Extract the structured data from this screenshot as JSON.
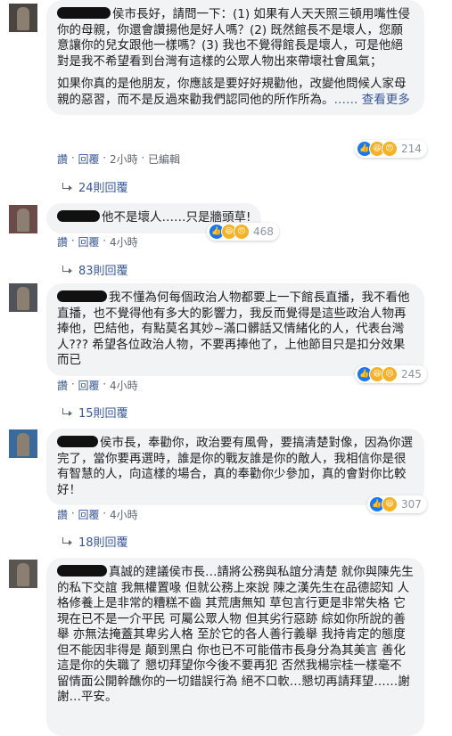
{
  "comments": [
    {
      "text_paragraphs": [
        "侯市長好，請問一下：(1) 如果有人天天照三頓用嘴性侵你的母親，你還會讚揚他是好人嗎？(2) 既然館長不是壞人，您願意讓你的兒女跟他一樣嗎？(3) 我也不覺得館長是壞人，可是他絕對是我不希望看到台灣有這樣的公眾人物出來帶壞社會風氣；",
        "如果你真的是他朋友，你應該是要好好規勸他，改變他問候人家母親的惡習，而不是反過來勸我們認同他的所作所為。"
      ],
      "see_more": "…… 查看更多",
      "reaction_count": "214",
      "actions": {
        "like": "讚",
        "reply": "回覆",
        "time": "2小時",
        "edited": "已編輯"
      },
      "replies_label": "24則回覆"
    },
    {
      "text_paragraphs": [
        "他不是壞人……只是牆頭草!"
      ],
      "reaction_count": "468",
      "actions": {
        "like": "讚",
        "reply": "回覆",
        "time": "4小時"
      },
      "replies_label": "83則回覆"
    },
    {
      "text_paragraphs": [
        "我不懂為何每個政治人物都要上一下館長直播，我不看他直播，也不覺得他有多大的影響力，我反而覺得是這些政治人物再捧他，巴結他，有點莫名其妙~滿口髒話又情緒化的人，代表台灣人??? 希望各位政治人物，不要再捧他了，上他節目只是扣分效果而已"
      ],
      "reaction_count": "245",
      "actions": {
        "like": "讚",
        "reply": "回覆",
        "time": "4小時"
      },
      "replies_label": "15則回覆"
    },
    {
      "text_paragraphs": [
        "侯市長，奉勸你，政治要有風骨，要搞清楚對像，因為你選完了，當你要再選時，誰是你的戰友誰是你的敵人，我相信你是很有智慧的人，向這樣的場合，真的奉勸你少參加，真的會對你比較好！"
      ],
      "reaction_count": "307",
      "actions": {
        "like": "讚",
        "reply": "回覆",
        "time": "4小時"
      },
      "replies_label": "18則回覆"
    },
    {
      "text_paragraphs": [
        "真誠的建議侯市長…請將公務與私誼分清楚 就你與陳先生的私下交誼 我無權置喙 但就公務上來說 陳之漢先生在品德認知 人格修養上是非常的糟糕不齒 其荒唐無知 草包言行更是非常失格 它現在已不是一介平民 可屬公眾人物 但其劣行惡跡 綜如你所說的善舉 亦無法掩蓋其卑劣人格 至於它的各人善行義舉 我持肯定的態度 但不能因非得是 顛到黑白 你也已不可能借市長身分為其美言 善化 這是你的失職了 懇切拜望你今後不要再犯 否然我楊宗桂一樣毫不留情面公開幹醮你的一切錯誤行為 絕不口軟…懇切再請拜望……謝謝…平安。"
      ]
    }
  ],
  "colors": {
    "like": "#1877f2",
    "link": "#385898",
    "bubble": "#f2f3f5",
    "meta": "#606770"
  }
}
